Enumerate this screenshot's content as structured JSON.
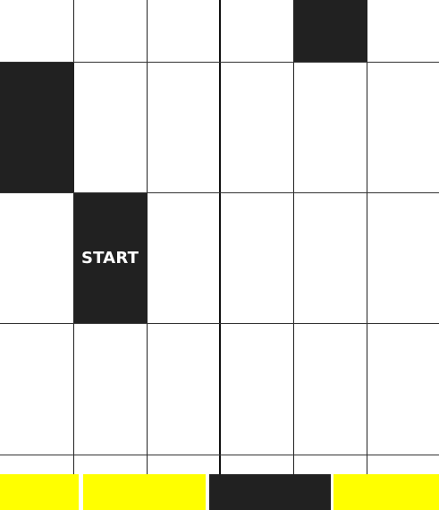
{
  "game": {
    "start_label": "START",
    "columns": 6,
    "colors": {
      "black_tile": "#212121",
      "white_tile": "#ffffff",
      "grid_line": "#222222",
      "bar_yellow": "#ffff00",
      "bar_dark": "#212121",
      "bar_gap": "#ffffff"
    },
    "rows": [
      {
        "tiles": [
          "white",
          "white",
          "white",
          "white",
          "black",
          "white"
        ]
      },
      {
        "tiles": [
          "black",
          "white",
          "white",
          "white",
          "white",
          "white"
        ]
      },
      {
        "tiles": [
          "white",
          "start",
          "white",
          "white",
          "white",
          "white"
        ]
      },
      {
        "tiles": [
          "white",
          "white",
          "white",
          "white",
          "white",
          "white"
        ]
      },
      {
        "tiles": [
          "white",
          "white",
          "white",
          "white",
          "white",
          "white"
        ]
      }
    ],
    "bottom_bar": [
      "yellow",
      "yellow",
      "dark",
      "yellow"
    ]
  }
}
